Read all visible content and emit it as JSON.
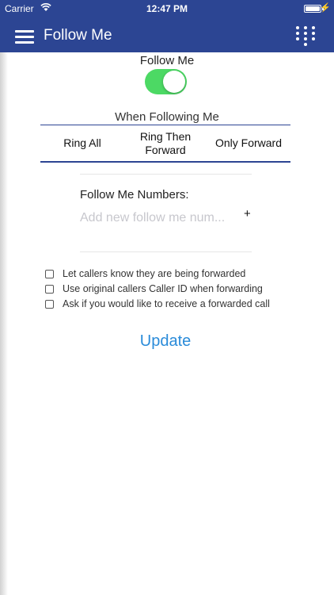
{
  "status_bar": {
    "carrier": "Carrier",
    "time": "12:47 PM",
    "battery_level_percent": 100
  },
  "nav": {
    "title": "Follow Me",
    "menu_icon": "menu-icon",
    "dialpad_icon": "dialpad-icon"
  },
  "follow_me": {
    "label": "Follow Me",
    "enabled": true
  },
  "when_following": {
    "title": "When Following Me",
    "options": [
      "Ring All",
      "Ring Then Forward",
      "Only Forward"
    ]
  },
  "numbers": {
    "label": "Follow Me Numbers:",
    "placeholder": "Add new follow me num...",
    "add_label": "+"
  },
  "checkboxes": [
    {
      "label": "Let callers know they are being forwarded",
      "checked": false
    },
    {
      "label": "Use original callers Caller ID when forwarding",
      "checked": false
    },
    {
      "label": "Ask if you would like to receive a forwarded call",
      "checked": false
    }
  ],
  "update_label": "Update",
  "colors": {
    "header": "#2c4593",
    "toggle_on": "#4cd964",
    "accent": "#2a8bd9"
  }
}
